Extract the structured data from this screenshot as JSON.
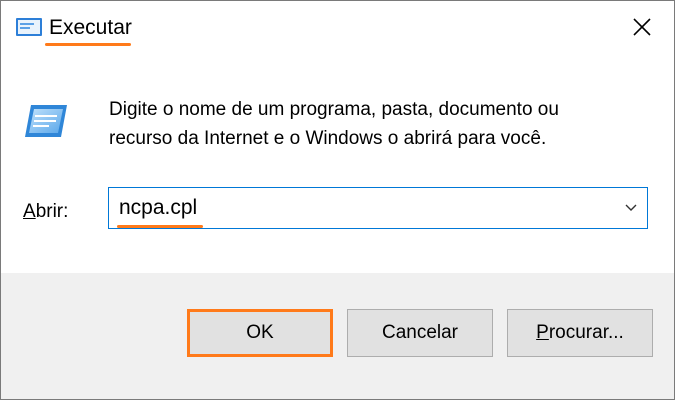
{
  "window": {
    "title": "Executar",
    "accent_color": "#ff7a1a",
    "focus_color": "#0078d7"
  },
  "icons": {
    "app": "run-icon",
    "close": "close-icon",
    "dropdown": "chevron-down-icon"
  },
  "dialog": {
    "message_line1": "Digite o nome de um programa, pasta, documento ou",
    "message_line2": "recurso da Internet e o Windows o abrirá para você.",
    "open_label_mnemonic": "A",
    "open_label_rest": "brir:",
    "open_value": "ncpa.cpl"
  },
  "buttons": {
    "ok": "OK",
    "cancel": "Cancelar",
    "browse_mnemonic": "P",
    "browse_rest": "rocurar..."
  }
}
